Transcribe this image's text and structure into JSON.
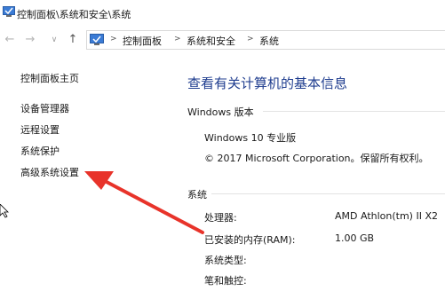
{
  "window": {
    "title": "控制面板\\系统和安全\\系统"
  },
  "nav": {
    "back_icon": "left-arrow-icon",
    "forward_icon": "right-arrow-icon",
    "up_icon": "up-arrow-icon",
    "breadcrumb": [
      "控制面板",
      "系统和安全",
      "系统"
    ]
  },
  "left_nav": {
    "home": "控制面板主页",
    "links": [
      "设备管理器",
      "远程设置",
      "系统保护",
      "高级系统设置"
    ]
  },
  "main": {
    "heading": "查看有关计算机的基本信息",
    "windows_edition": {
      "section_title": "Windows 版本",
      "edition": "Windows 10 专业版",
      "copyright": "© 2017 Microsoft Corporation。保留所有权利。"
    },
    "system": {
      "section_title": "系统",
      "rows": [
        {
          "label": "处理器:",
          "value": "AMD Athlon(tm) II X2"
        },
        {
          "label": "已安装的内存(RAM):",
          "value": "1.00 GB"
        },
        {
          "label": "系统类型:",
          "value": ""
        },
        {
          "label": "笔和触控:",
          "value": ""
        }
      ]
    }
  },
  "colors": {
    "heading": "#1f3d8f",
    "arrow": "#e8332a"
  }
}
